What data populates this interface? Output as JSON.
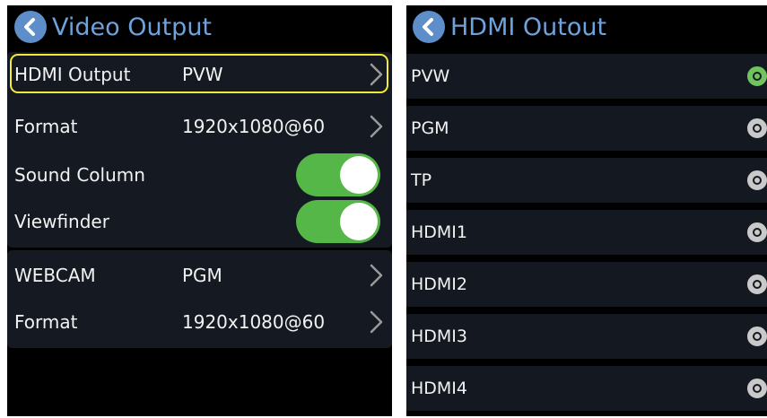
{
  "colors": {
    "accent": "#6ea2dc",
    "back_button": "#5d8ec9",
    "focus_outline": "#f3ea37",
    "toggle_on": "#55b748",
    "radio_selected": "#6fc45e",
    "radio_unselected": "#c9c9c9"
  },
  "video_output": {
    "title": "Video Output",
    "back_icon": "chevron-left-icon",
    "rows": [
      {
        "label": "HDMI Output",
        "value": "PVW",
        "focused": true
      },
      {
        "label": "Format",
        "value": "1920x1080@60"
      },
      {
        "label": "Sound Column",
        "toggle": true
      },
      {
        "label": "Viewfinder",
        "toggle": true
      },
      {
        "label": "WEBCAM",
        "value": "PGM"
      },
      {
        "label": "Format",
        "value": "1920x1080@60"
      }
    ]
  },
  "hdmi_output": {
    "title": "HDMI Outout",
    "back_icon": "chevron-left-icon",
    "options": [
      {
        "label": "PVW",
        "selected": true
      },
      {
        "label": "PGM",
        "selected": false
      },
      {
        "label": "TP",
        "selected": false
      },
      {
        "label": "HDMI1",
        "selected": false
      },
      {
        "label": "HDMI2",
        "selected": false
      },
      {
        "label": "HDMI3",
        "selected": false
      },
      {
        "label": "HDMI4",
        "selected": false
      }
    ]
  }
}
